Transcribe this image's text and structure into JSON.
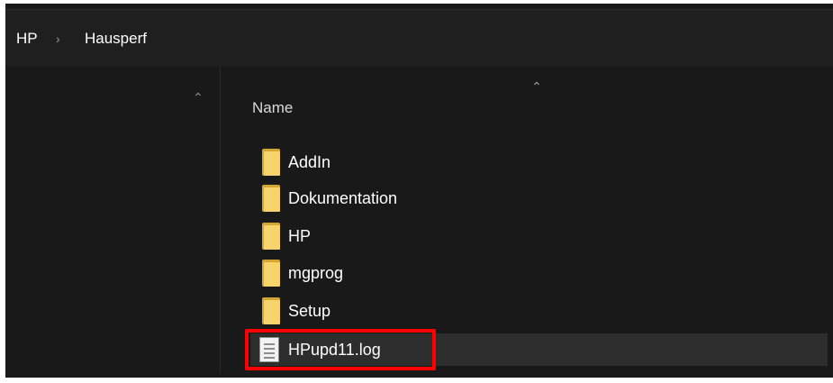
{
  "breadcrumb": {
    "items": [
      "HP",
      "Hausperf"
    ],
    "separator": "›"
  },
  "file_list": {
    "column_header": "Name",
    "items": [
      {
        "name": "AddIn",
        "type": "folder"
      },
      {
        "name": "Dokumentation",
        "type": "folder"
      },
      {
        "name": "HP",
        "type": "folder"
      },
      {
        "name": "mgprog",
        "type": "folder"
      },
      {
        "name": "Setup",
        "type": "folder"
      },
      {
        "name": "HPupd11.log",
        "type": "file",
        "selected": true,
        "highlighted": true
      }
    ]
  },
  "icons": {
    "folder": "folder-icon",
    "file": "text-file-icon",
    "sort": "chevron-up-icon",
    "nav_scroll": "chevron-up-icon"
  },
  "colors": {
    "background": "#191919",
    "highlight_border": "#ff0000",
    "folder": "#f7d36b",
    "selected_row": "#2d2d2d"
  }
}
